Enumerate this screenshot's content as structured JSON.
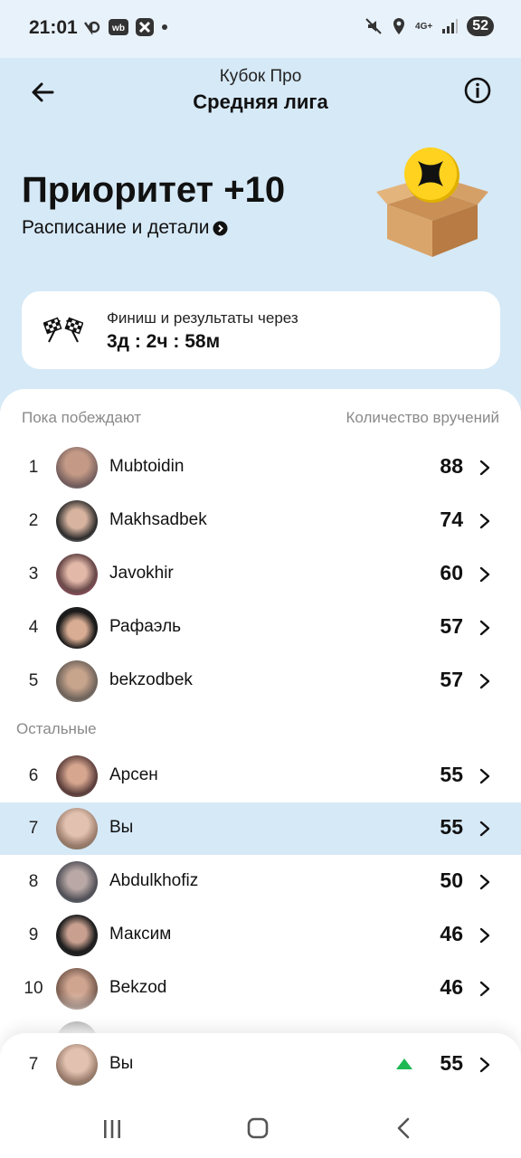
{
  "status": {
    "time": "21:01",
    "network": "4G+",
    "battery": "52"
  },
  "header": {
    "subtitle": "Кубок Про",
    "title": "Средняя лига"
  },
  "promo": {
    "title": "Приоритет +10",
    "link": "Расписание и детали"
  },
  "timer": {
    "label": "Финиш и результаты через",
    "value": "3д : 2ч : 58м"
  },
  "list": {
    "winners_label": "Пока побеждают",
    "count_label": "Количество вручений",
    "others_label": "Остальные",
    "winners": [
      {
        "rank": "1",
        "name": "Mubtoidin",
        "score": "88"
      },
      {
        "rank": "2",
        "name": "Makhsadbek",
        "score": "74"
      },
      {
        "rank": "3",
        "name": "Javokhir",
        "score": "60"
      },
      {
        "rank": "4",
        "name": "Рафаэль",
        "score": "57"
      },
      {
        "rank": "5",
        "name": "bekzodbek",
        "score": "57"
      }
    ],
    "others": [
      {
        "rank": "6",
        "name": "Арсен",
        "score": "55"
      },
      {
        "rank": "7",
        "name": "Вы",
        "score": "55"
      },
      {
        "rank": "8",
        "name": "Abdulkhofiz",
        "score": "50"
      },
      {
        "rank": "9",
        "name": "Максим",
        "score": "46"
      },
      {
        "rank": "10",
        "name": "Bekzod",
        "score": "46"
      }
    ]
  },
  "me": {
    "rank": "7",
    "name": "Вы",
    "score": "55",
    "trend": "up"
  },
  "colors": {
    "background": "#d6e9f7",
    "highlight": "#d6e9f7",
    "trend_up": "#1fb954",
    "coin": "#ffd21f"
  }
}
